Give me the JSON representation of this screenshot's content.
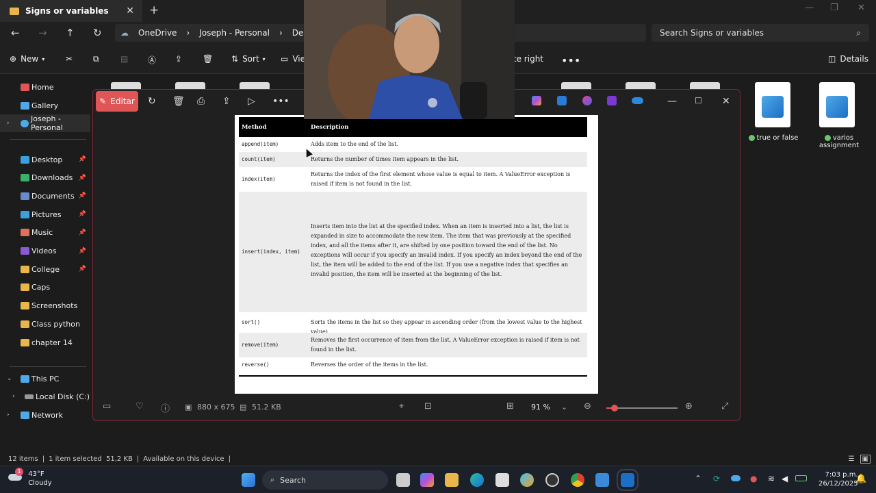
{
  "explorer": {
    "tab_title": "Signs or variables",
    "breadcrumb": [
      "OneDrive",
      "Joseph - Personal",
      "Desktop"
    ],
    "search_placeholder": "Search Signs or variables",
    "commands": {
      "new": "New",
      "sort": "Sort",
      "view": "View",
      "rotate_right": "Rotate right",
      "details": "Details"
    },
    "sidebar": {
      "top": [
        {
          "label": "Home",
          "icon": "home-icon",
          "color": "#e05555"
        },
        {
          "label": "Gallery",
          "icon": "gallery-icon",
          "color": "#4fa8e8"
        },
        {
          "label": "Joseph - Personal",
          "icon": "onedrive-icon",
          "color": "#4fa8e8"
        }
      ],
      "pinned": [
        {
          "label": "Desktop",
          "color": "#3aa0e0"
        },
        {
          "label": "Downloads",
          "color": "#3ab06a"
        },
        {
          "label": "Documents",
          "color": "#6a8ad0"
        },
        {
          "label": "Pictures",
          "color": "#3aa0e0"
        },
        {
          "label": "Music",
          "color": "#e0705a"
        },
        {
          "label": "Videos",
          "color": "#8a5ad0"
        },
        {
          "label": "College",
          "color": "#e8b64a"
        }
      ],
      "folders": [
        "Caps",
        "Screenshots",
        "Class python",
        "chapter 14"
      ],
      "bottom": [
        {
          "label": "This PC",
          "icon": "pc-icon"
        },
        {
          "label": "Local Disk (C:)",
          "icon": "disk-icon"
        },
        {
          "label": "Network",
          "icon": "network-icon"
        }
      ]
    },
    "files": [
      {
        "label": "true or false"
      },
      {
        "label": "varios assignment"
      }
    ],
    "status": {
      "items": "12 items",
      "selected": "1 item selected  51,2 KB",
      "availability": "Available on this device"
    }
  },
  "viewer": {
    "edit_label": "Editar",
    "dimensions": "880 x 675",
    "size": "51.2 KB",
    "zoom": "91 %",
    "zoom_fraction": 0.12
  },
  "doc_table": {
    "header": {
      "method": "Method",
      "description": "Description"
    },
    "rows": [
      {
        "method": "append(item)",
        "description": "Adds item to the end of the list."
      },
      {
        "method": "count(item)",
        "description": "Returns the number of times item appears in the list."
      },
      {
        "method": "index(item)",
        "description": "Returns the index of the first element whose value is equal to item. A ValueError exception is raised if item is not found in the list."
      },
      {
        "method": "insert(index, item)",
        "description": "Inserts item into the list at the specified index. When an item is inserted into a list, the list is expanded in size to accommodate the new item. The item that was previously at the specified index, and all the items after it, are shifted by one position toward the end of the list. No exceptions will occur if you specify an invalid index. If you specify an index beyond the end of the list, the item will be added to the end of the list. If you use a negative index that specifies an invalid position, the item will be inserted at the beginning of the list."
      },
      {
        "method": "sort()",
        "description": "Sorts the items in the list so they appear in ascending order (from the lowest value to the highest value)."
      },
      {
        "method": "remove(item)",
        "description": "Removes the first occurrence of item from the list. A ValueError exception is raised if item is not found in the list."
      },
      {
        "method": "reverse()",
        "description": "Reverses the order of the items in the list."
      }
    ]
  },
  "taskbar": {
    "weather_temp": "43°F",
    "weather_desc": "Cloudy",
    "weather_badge": "1",
    "search_label": "Search",
    "time": "7:03 p.m.",
    "date": "26/12/2025"
  }
}
